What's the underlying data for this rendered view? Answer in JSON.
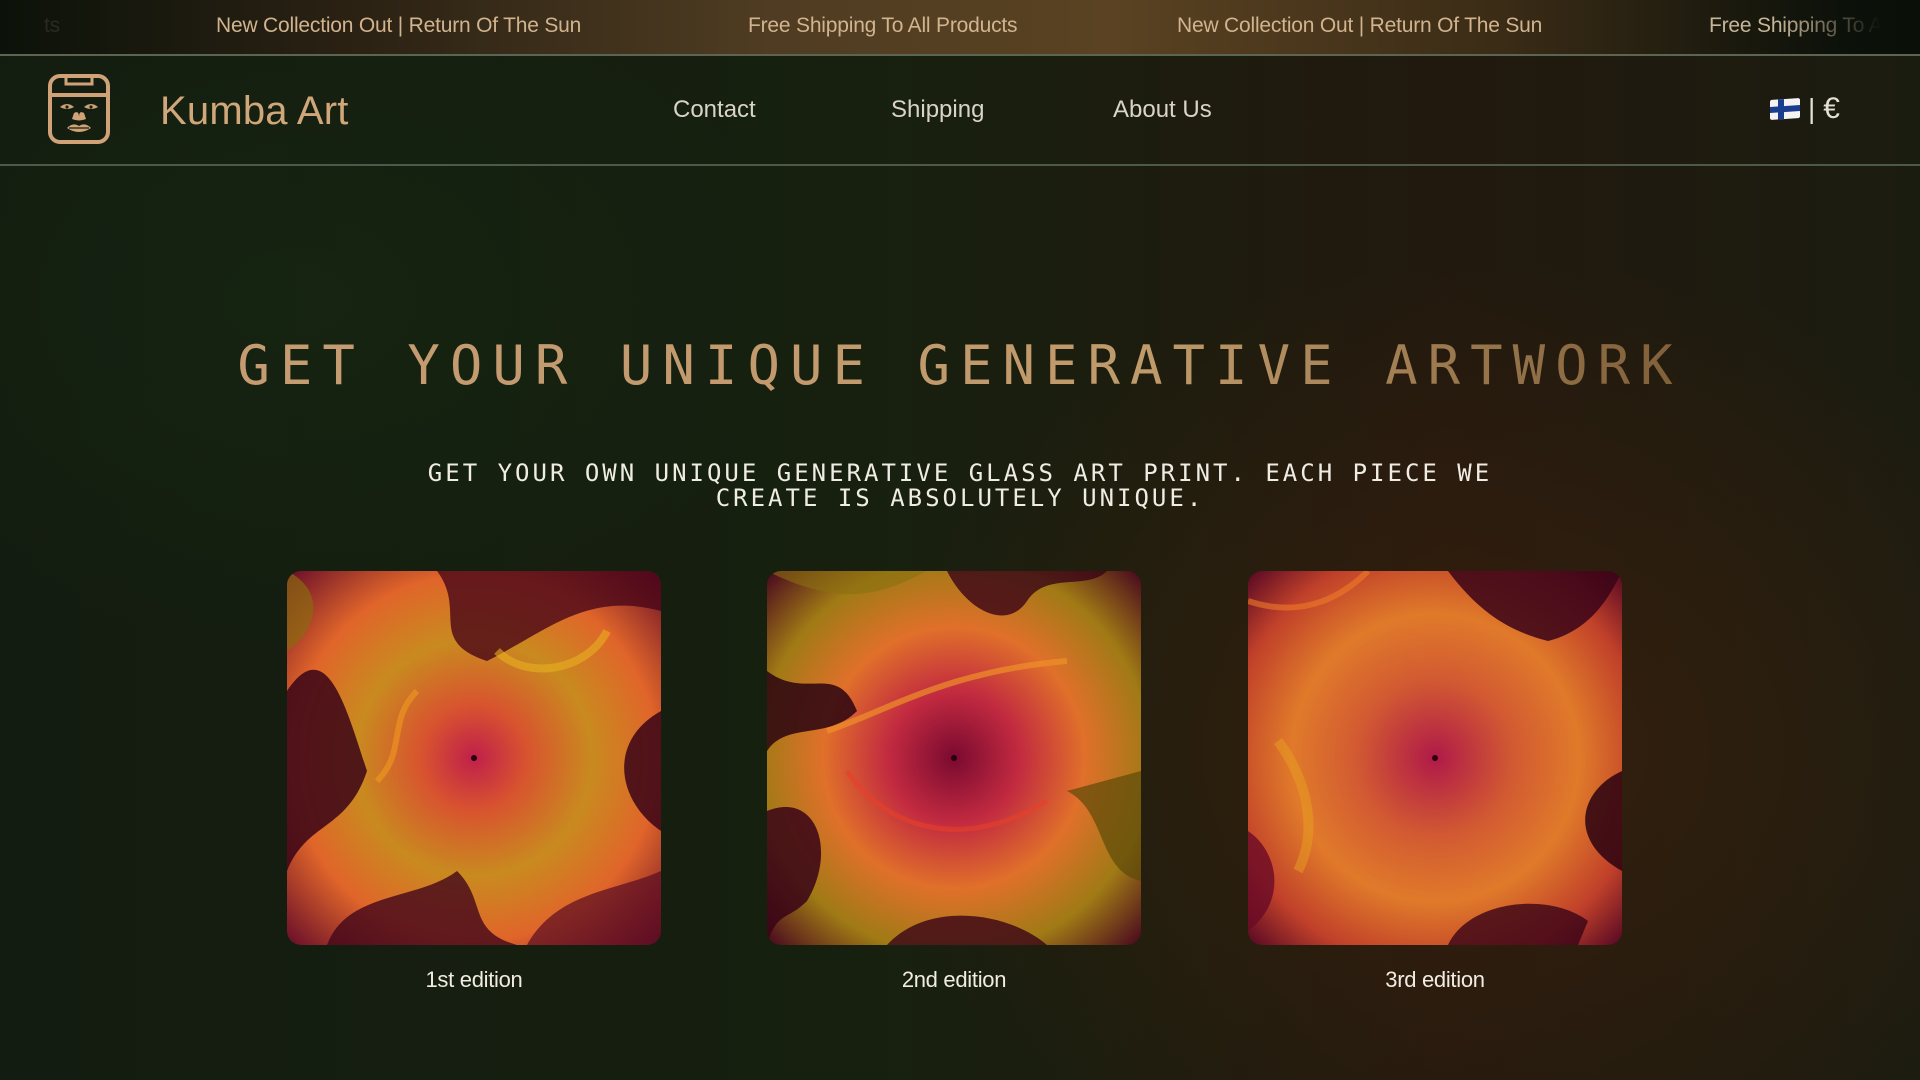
{
  "announcement_bar": {
    "items": [
      "ts",
      "New Collection Out | Return Of The Sun",
      "Free Shipping To All Products",
      "New Collection Out | Return Of The Sun",
      "Free Shipping To A"
    ]
  },
  "header": {
    "logo_icon": "face-tablet-icon",
    "brand": "Kumba Art",
    "nav": [
      "Contact",
      "Shipping",
      "About Us"
    ],
    "locale": {
      "flag": "finland-flag-icon",
      "separator": "|",
      "currency": "€"
    }
  },
  "hero": {
    "title": "GET YOUR UNIQUE GENERATIVE ARTWORK",
    "subtitle": "GET YOUR OWN UNIQUE GENERATIVE GLASS ART PRINT. EACH PIECE WE CREATE IS ABSOLUTELY UNIQUE."
  },
  "products": [
    {
      "caption": "1st edition",
      "image": "generative-swirl-artwork"
    },
    {
      "caption": "2nd edition",
      "image": "generative-swirl-artwork"
    },
    {
      "caption": "3rd edition",
      "image": "generative-swirl-artwork"
    }
  ],
  "colors": {
    "accent": "#d0a77a",
    "banner_text": "#d1b48f",
    "background": "#17200f",
    "text": "#efece4"
  }
}
